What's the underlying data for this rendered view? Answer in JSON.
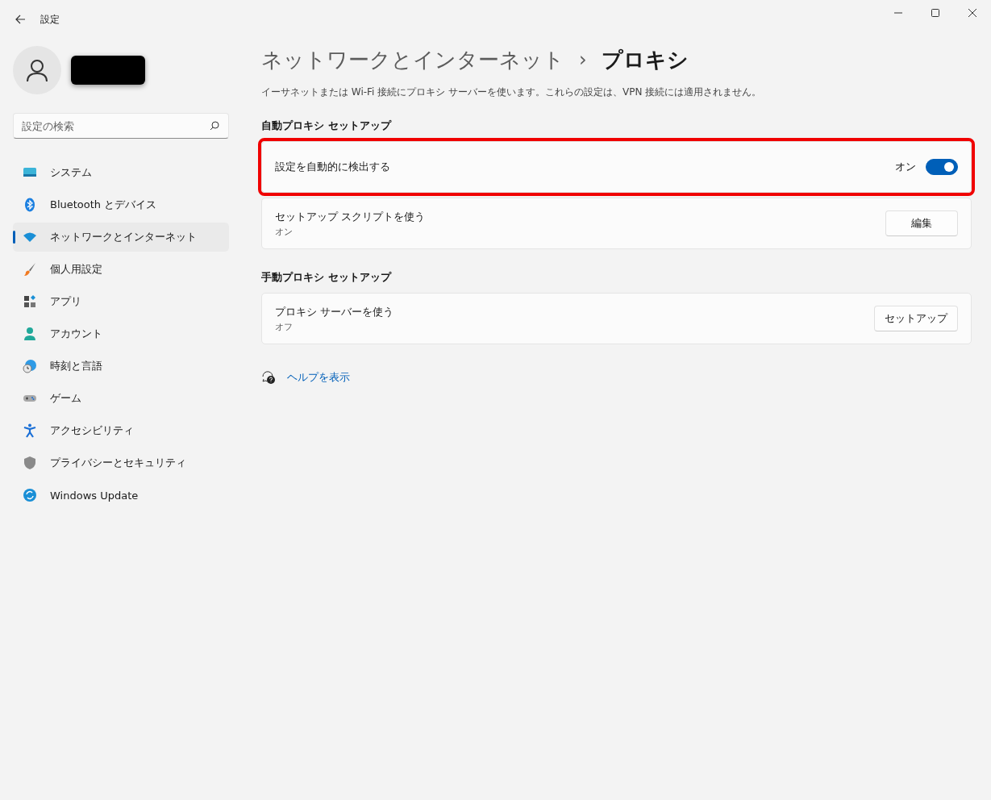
{
  "window": {
    "title": "設定"
  },
  "account": {
    "redacted": true
  },
  "search": {
    "placeholder": "設定の検索"
  },
  "sidebar": {
    "items": [
      {
        "label": "システム",
        "selected": false
      },
      {
        "label": "Bluetooth とデバイス",
        "selected": false
      },
      {
        "label": "ネットワークとインターネット",
        "selected": true
      },
      {
        "label": "個人用設定",
        "selected": false
      },
      {
        "label": "アプリ",
        "selected": false
      },
      {
        "label": "アカウント",
        "selected": false
      },
      {
        "label": "時刻と言語",
        "selected": false
      },
      {
        "label": "ゲーム",
        "selected": false
      },
      {
        "label": "アクセシビリティ",
        "selected": false
      },
      {
        "label": "プライバシーとセキュリティ",
        "selected": false
      },
      {
        "label": "Windows Update",
        "selected": false
      }
    ]
  },
  "breadcrumb": {
    "parent": "ネットワークとインターネット",
    "separator": "›",
    "current": "プロキシ"
  },
  "description": "イーサネットまたは Wi-Fi 接続にプロキシ サーバーを使います。これらの設定は、VPN 接続には適用されません。",
  "sections": [
    {
      "heading": "自動プロキシ セットアップ",
      "rows": [
        {
          "kind": "toggle",
          "title": "設定を自動的に検出する",
          "state_label": "オン",
          "on": true,
          "highlighted": true
        },
        {
          "kind": "button",
          "title": "セットアップ スクリプトを使う",
          "subtitle": "オン",
          "button": "編集",
          "highlighted": false
        }
      ]
    },
    {
      "heading": "手動プロキシ セットアップ",
      "rows": [
        {
          "kind": "button",
          "title": "プロキシ サーバーを使う",
          "subtitle": "オフ",
          "button": "セットアップ",
          "highlighted": false
        }
      ]
    }
  ],
  "help_link": "ヘルプを表示"
}
